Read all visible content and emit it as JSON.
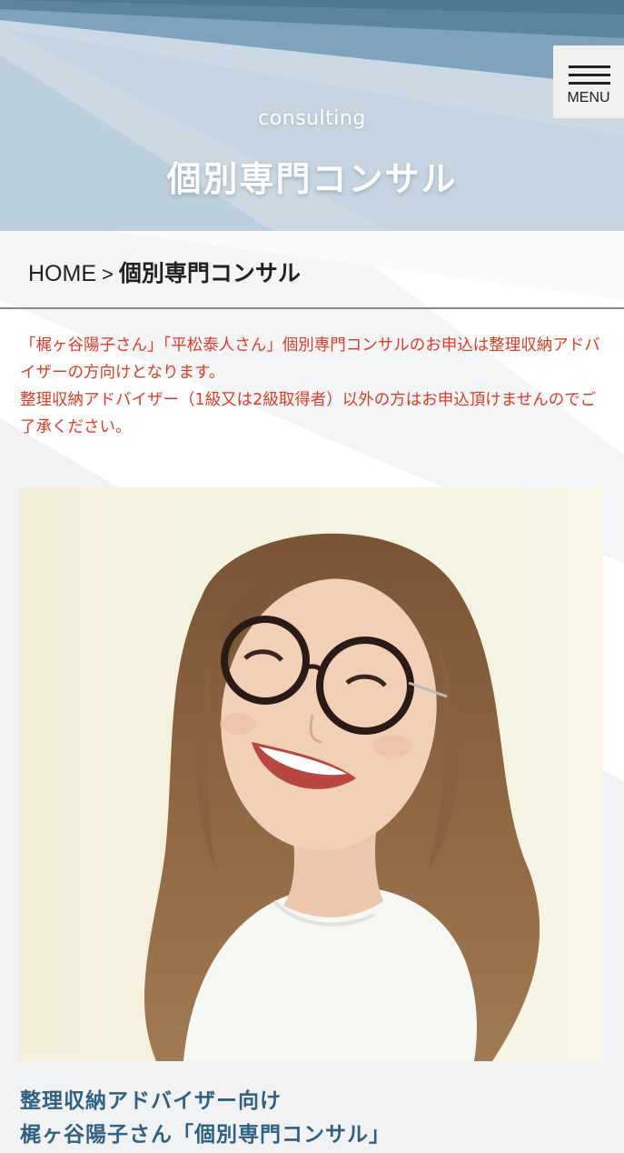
{
  "header": {
    "subtitle": "consulting",
    "title": "個別専門コンサル",
    "menu_label": "MENU"
  },
  "breadcrumb": {
    "home": "HOME",
    "separator": ">",
    "current": "個別専門コンサル"
  },
  "notice": {
    "paragraph1": "「梶ヶ谷陽子さん」「平松泰人さん」個別専門コンサルのお申込は整理収納アドバイザーの方向けとなります。",
    "paragraph2": "整理収納アドバイザー（1級又は2級取得者）以外の方はお申込頂けませんのでご了承ください。"
  },
  "feature": {
    "line1": "整理収納アドバイザー向け",
    "line2": "梶ヶ谷陽子さん「個別専門コンサル」"
  },
  "colors": {
    "notice_text": "#e23a25",
    "heading_text": "#2f6183",
    "header_blue": "#b8ccd9"
  }
}
